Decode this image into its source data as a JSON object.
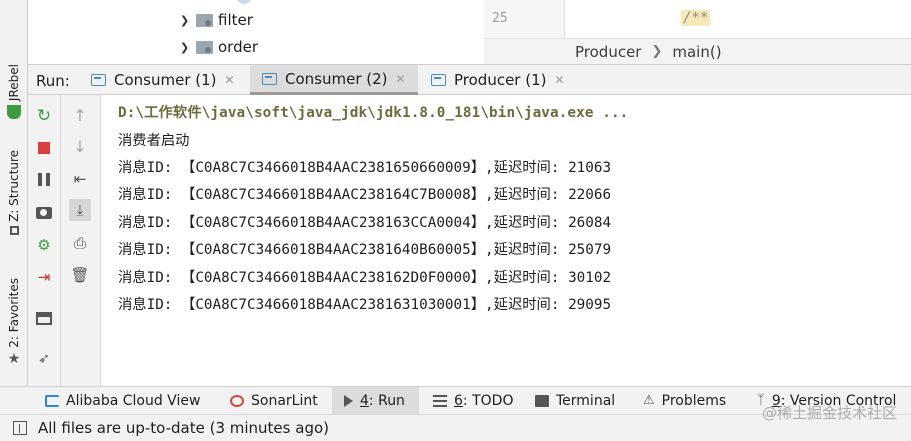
{
  "project_tree": {
    "items": [
      {
        "label": "filter",
        "icon": "folder-icon"
      },
      {
        "label": "order",
        "icon": "folder-icon"
      }
    ]
  },
  "editor": {
    "line_number": "25",
    "code_snippet": "/**",
    "breadcrumb": [
      "Producer",
      "main()"
    ]
  },
  "left_strip": {
    "tabs": [
      "JRebel",
      "Z: Structure",
      "2: Favorites"
    ]
  },
  "run_panel": {
    "label": "Run:",
    "tabs": [
      {
        "label": "Consumer (1)",
        "active": false
      },
      {
        "label": "Consumer (2)",
        "active": true
      },
      {
        "label": "Producer (1)",
        "active": false
      }
    ]
  },
  "console": {
    "lines": [
      "D:\\工作软件\\java\\soft\\java_jdk\\jdk1.8.0_181\\bin\\java.exe ...",
      "消费者启动",
      "消息ID: 【C0A8C7C3466018B4AAC2381650660009】,延迟时间: 21063",
      "消息ID: 【C0A8C7C3466018B4AAC238164C7B0008】,延迟时间: 22066",
      "消息ID: 【C0A8C7C3466018B4AAC238163CCA0004】,延迟时间: 26084",
      "消息ID: 【C0A8C7C3466018B4AAC2381640B60005】,延迟时间: 25079",
      "消息ID: 【C0A8C7C3466018B4AAC238162D0F0000】,延迟时间: 30102",
      "消息ID: 【C0A8C7C3466018B4AAC2381631030001】,延迟时间: 29095"
    ]
  },
  "bottom_tools": {
    "alibaba": "Alibaba Cloud View",
    "sonar": "SonarLint",
    "run_key": "4",
    "run_label": ": Run",
    "todo_key": "6",
    "todo_label": ": TODO",
    "terminal": "Terminal",
    "problems": "Problems",
    "vc_key": "9",
    "vc_label": ": Version Control"
  },
  "status": {
    "message": "All files are up-to-date (3 minutes ago)",
    "watermark": "@稀土掘金技术社区"
  },
  "colors": {
    "accent_blue": "#4e8bb8",
    "stop_red": "#d94040",
    "rerun_green": "#3e9a3e",
    "command_text": "#6b6b3c"
  }
}
